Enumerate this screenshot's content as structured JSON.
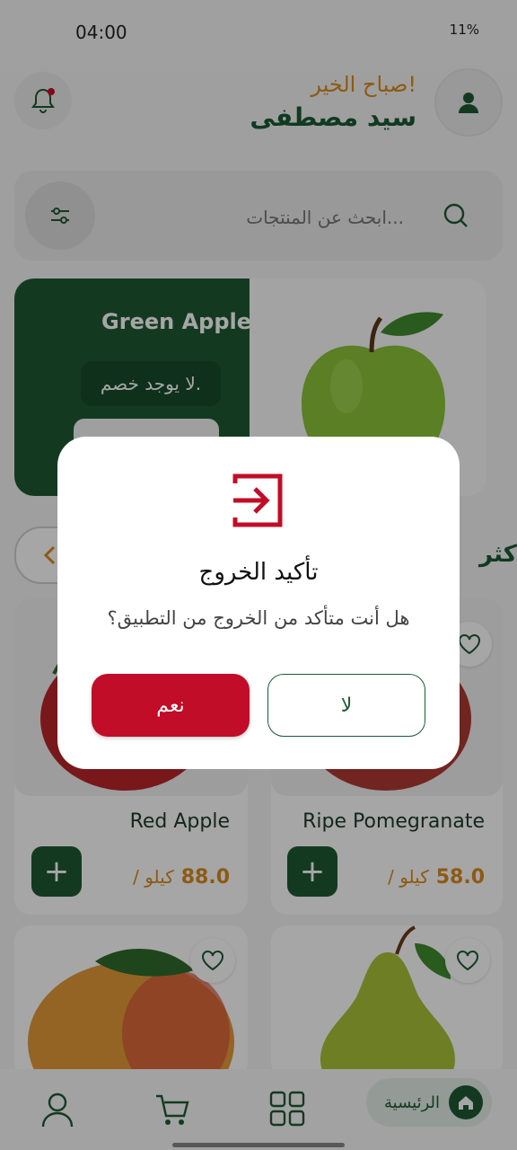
{
  "status": {
    "time": "04:00",
    "battery": "11%"
  },
  "header": {
    "greeting": "صباح الخير!",
    "user_name": "سيد مصطفى"
  },
  "search": {
    "placeholder": "ابحث عن المنتجات..."
  },
  "banner": {
    "title": "Green Apple",
    "badge": "لا يوجد خصم."
  },
  "section": {
    "title": "الأكثر"
  },
  "products": [
    {
      "name": "Ripe Pomegranate",
      "price": "58.0",
      "unit": "/ كيلو"
    },
    {
      "name": "Red Apple",
      "price": "88.0",
      "unit": "/ كيلو"
    }
  ],
  "nav": {
    "home_label": "الرئيسية"
  },
  "dialog": {
    "title": "تأكيد الخروج",
    "message": "هل أنت متأكد من الخروج من التطبيق؟",
    "yes_label": "نعم",
    "no_label": "لا"
  },
  "colors": {
    "brand_green": "#1e5a34",
    "accent_orange": "#d98b1e",
    "danger_red": "#c10d27"
  },
  "icons": [
    "bell-icon",
    "user-icon",
    "search-icon",
    "filter-icon",
    "chevron-left-icon",
    "heart-icon",
    "plus-icon",
    "home-icon",
    "grid-icon",
    "cart-icon",
    "profile-icon",
    "exit-icon"
  ]
}
